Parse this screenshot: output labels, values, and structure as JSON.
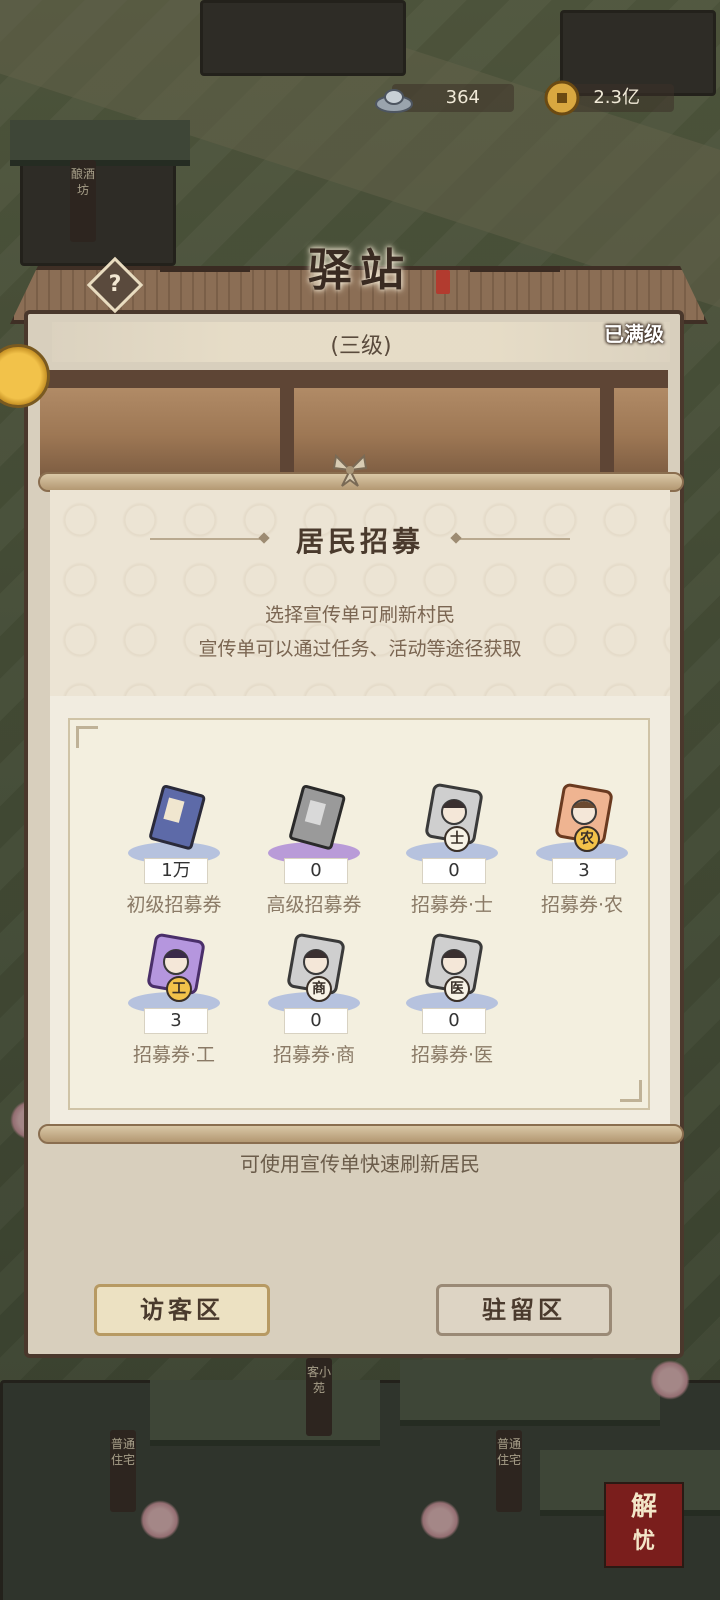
{
  "currency": {
    "silver": "364",
    "coins": "2.3亿"
  },
  "building": {
    "title": "驿站",
    "seal_text": "",
    "help_label": "?",
    "level": "(三级)",
    "status": "已满级"
  },
  "dialog": {
    "title": "居民招募",
    "desc_line1": "选择宣传单可刷新村民",
    "desc_line2": "宣传单可以通过任务、活动等途径获取",
    "items": [
      {
        "name": "初级招募券",
        "count": "1万",
        "badge": ""
      },
      {
        "name": "高级招募券",
        "count": "0",
        "badge": ""
      },
      {
        "name": "招募券·士",
        "count": "0",
        "badge": "士"
      },
      {
        "name": "招募券·农",
        "count": "3",
        "badge": "农"
      },
      {
        "name": "招募券·工",
        "count": "3",
        "badge": "工"
      },
      {
        "name": "招募券·商",
        "count": "0",
        "badge": "商"
      },
      {
        "name": "招募券·医",
        "count": "0",
        "badge": "医"
      }
    ]
  },
  "hint": "可使用宣传单快速刷新居民",
  "tabs": {
    "visitor": "访客区",
    "stay": "驻留区"
  },
  "town_signs": {
    "inn": "客小苑",
    "house_left": "普通住宅",
    "house_mid": "普通住宅",
    "wine": "酿酒坊"
  },
  "corner_button": {
    "line1": "解",
    "line2": "忧"
  },
  "colors": {
    "panel": "#d8cfbd",
    "dialog": "#f1ece0",
    "accent_text": "#4a3a2d"
  }
}
